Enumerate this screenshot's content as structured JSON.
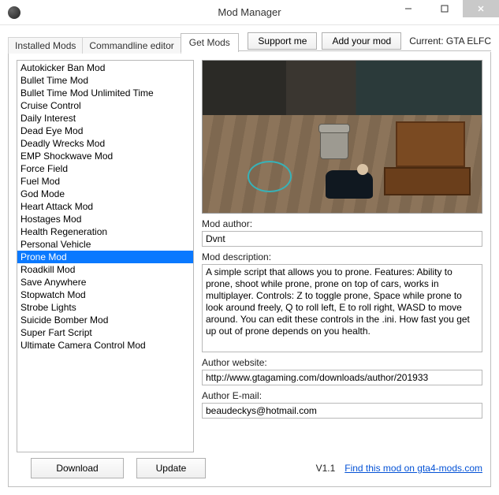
{
  "window": {
    "title": "Mod Manager"
  },
  "tabs": {
    "installed": "Installed Mods",
    "commandline": "Commandline editor",
    "get": "Get Mods"
  },
  "topButtons": {
    "support": "Support me",
    "addMod": "Add your mod"
  },
  "currentLabel": "Current: GTA ELFC",
  "mods": {
    "items": [
      "Autokicker Ban Mod",
      "Bullet Time Mod",
      "Bullet Time Mod Unlimited Time",
      "Cruise Control",
      "Daily Interest",
      "Dead Eye Mod",
      "Deadly Wrecks Mod",
      "EMP Shockwave Mod",
      "Force Field",
      "Fuel Mod",
      "God Mode",
      "Heart Attack Mod",
      "Hostages Mod",
      "Health Regeneration",
      "Personal Vehicle",
      "Prone Mod",
      "Roadkill Mod",
      "Save Anywhere",
      "Stopwatch Mod",
      "Strobe Lights",
      "Suicide Bomber Mod",
      "Super Fart Script",
      "Ultimate Camera Control Mod"
    ],
    "selectedIndex": 15
  },
  "detail": {
    "authorLabel": "Mod author:",
    "author": "Dvnt",
    "descLabel": "Mod description:",
    "desc": "A simple script that allows you to prone. Features: Ability to prone, shoot while prone, prone on top of cars, works in multiplayer. Controls: Z to toggle prone, Space while prone to look around freely, Q to roll left, E to roll right, WASD to move around. You can edit these controls in the .ini. How fast you get up out of prone depends on you health.",
    "websiteLabel": "Author website:",
    "website": "http://www.gtagaming.com/downloads/author/201933",
    "emailLabel": "Author E-mail:",
    "email": "beaudeckys@hotmail.com"
  },
  "bottom": {
    "download": "Download",
    "update": "Update",
    "version": "V1.1",
    "findLink": "Find this mod on gta4-mods.com"
  }
}
